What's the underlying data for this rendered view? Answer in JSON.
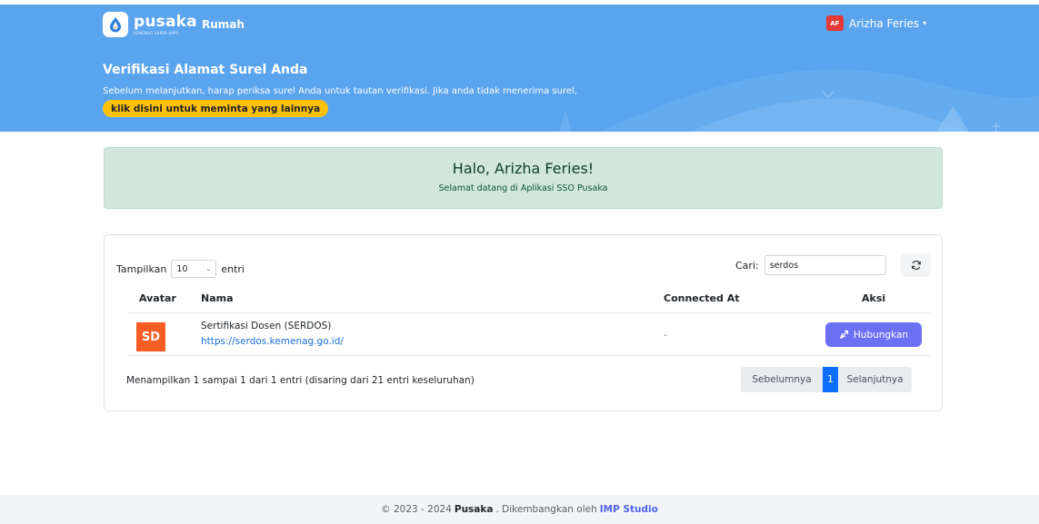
{
  "header": {
    "brand_name": "pusaka",
    "brand_sub": "KEMENAG SUPER APPS",
    "nav_home": "Rumah",
    "user_initials": "AF",
    "user_name": "Arizha Feries",
    "caret": "▾"
  },
  "verification": {
    "title": "Verifikasi Alamat Surel Anda",
    "message": "Sebelum melanjutkan, harap periksa surel Anda untuk tautan verifikasi. Jika anda tidak menerima surel,",
    "link_label": "klik disini untuk meminta yang lainnya"
  },
  "welcome": {
    "title": "Halo, Arizha Feries!",
    "subtitle": "Selamat datang di Aplikasi SSO Pusaka"
  },
  "table": {
    "show_label": "Tampilkan",
    "page_length": "10",
    "entries_label": "entri",
    "search_label": "Cari:",
    "search_value": "serdos",
    "columns": {
      "avatar": "Avatar",
      "name": "Nama",
      "connected_at": "Connected At",
      "action": "Aksi"
    },
    "rows": [
      {
        "avatar_text": "SD",
        "name": "Sertifikasi Dosen (SERDOS)",
        "url": "https://serdos.kemenag.go.id/",
        "connected_at": "-",
        "action_label": "Hubungkan"
      }
    ],
    "info": "Menampilkan 1 sampai 1 dari 1 entri (disaring dari 21 entri keseluruhan)",
    "pagination": {
      "prev": "Sebelumnya",
      "current": "1",
      "next": "Selanjutnya"
    }
  },
  "footer": {
    "copyright": "© 2023 - 2024",
    "brand": "Pusaka",
    "developed_by": ". Dikembangkan oleh",
    "studio": "IMP Studio"
  },
  "colors": {
    "hero": "#5aa4ee",
    "accent_yellow": "#ffc107",
    "success_bg": "#d1e7dd",
    "avatar_orange": "#fb5d23",
    "connect_button": "#6c70f3",
    "pager_active": "#0d6efd"
  },
  "icons": {
    "logo": "droplet-logo-icon",
    "refresh": "refresh-icon",
    "connect": "link-icon"
  }
}
